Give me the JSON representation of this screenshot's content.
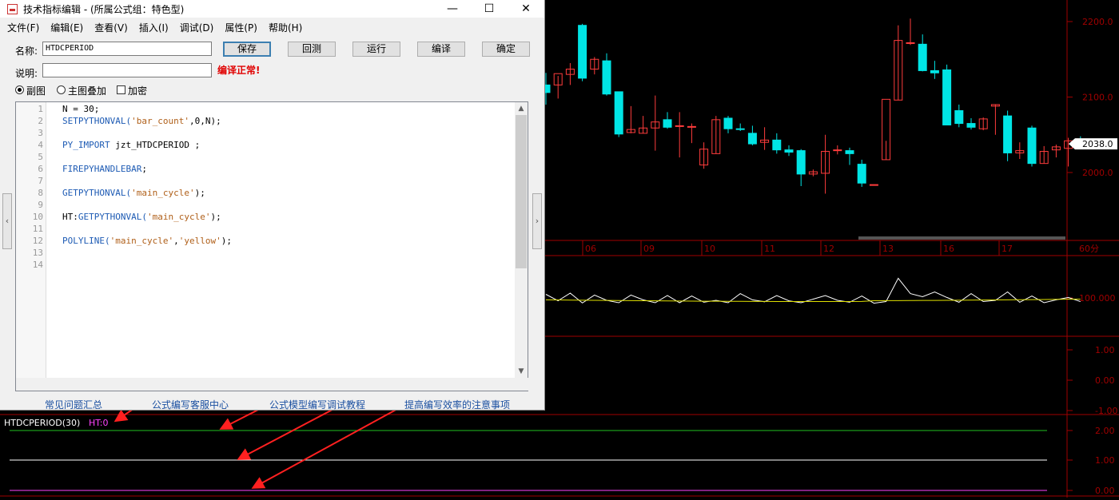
{
  "window": {
    "title": "技术指标编辑 - (所属公式组：特色型)",
    "minimize_glyph": "—",
    "maximize_glyph": "☐",
    "close_glyph": "✕"
  },
  "menu": [
    "文件(F)",
    "编辑(E)",
    "查看(V)",
    "插入(I)",
    "调试(D)",
    "属性(P)",
    "帮助(H)"
  ],
  "form": {
    "name_label": "名称:",
    "name_value": "HTDCPERIOD",
    "desc_label": "说明:",
    "desc_value": "",
    "compile_status": "编译正常!",
    "buttons": [
      "保存",
      "回测",
      "运行",
      "编译",
      "确定"
    ],
    "mode_sub": "副图",
    "mode_overlay": "主图叠加",
    "encrypt": "加密"
  },
  "code_lines": [
    {
      "n": "1",
      "segs": [
        {
          "t": "N = 30;",
          "c": "plain"
        }
      ]
    },
    {
      "n": "2",
      "segs": [
        {
          "t": "SETPYTHONVAL(",
          "c": "kw"
        },
        {
          "t": "'bar_count'",
          "c": "str"
        },
        {
          "t": ",0,N);",
          "c": "plain"
        }
      ]
    },
    {
      "n": "3",
      "segs": []
    },
    {
      "n": "4",
      "segs": [
        {
          "t": "PY_IMPORT",
          "c": "kw"
        },
        {
          "t": " jzt_HTDCPERIOD ;",
          "c": "plain"
        }
      ]
    },
    {
      "n": "5",
      "segs": []
    },
    {
      "n": "6",
      "segs": [
        {
          "t": "FIREPYHANDLEBAR",
          "c": "kw"
        },
        {
          "t": ";",
          "c": "plain"
        }
      ]
    },
    {
      "n": "7",
      "segs": []
    },
    {
      "n": "8",
      "segs": [
        {
          "t": "GETPYTHONVAL(",
          "c": "kw"
        },
        {
          "t": "'main_cycle'",
          "c": "str"
        },
        {
          "t": ");",
          "c": "plain"
        }
      ]
    },
    {
      "n": "9",
      "segs": []
    },
    {
      "n": "10",
      "segs": [
        {
          "t": "HT:",
          "c": "plain"
        },
        {
          "t": "GETPYTHONVAL(",
          "c": "kw"
        },
        {
          "t": "'main_cycle'",
          "c": "str"
        },
        {
          "t": ");",
          "c": "plain"
        }
      ]
    },
    {
      "n": "11",
      "segs": []
    },
    {
      "n": "12",
      "segs": [
        {
          "t": "POLYLINE(",
          "c": "kw"
        },
        {
          "t": "'main_cycle'",
          "c": "str"
        },
        {
          "t": ",",
          "c": "plain"
        },
        {
          "t": "'yellow'",
          "c": "str"
        },
        {
          "t": ");",
          "c": "plain"
        }
      ]
    },
    {
      "n": "13",
      "segs": []
    },
    {
      "n": "14",
      "segs": []
    }
  ],
  "footer_links": [
    "常见问题汇总",
    "公式编写客服中心",
    "公式模型编写调试教程",
    "提高编写效率的注意事项"
  ],
  "side_left_glyph": "‹",
  "side_right_glyph": "›",
  "main_chart": {
    "price_ticks": [
      "2200.0",
      "2100.0",
      "2000.0"
    ],
    "current_price": "2038.0",
    "date_ticks": [
      "06",
      "09",
      "10",
      "11",
      "12",
      "13",
      "16",
      "17"
    ],
    "period": "60分"
  },
  "sub_chart1": {
    "ticks": [
      "100.000"
    ]
  },
  "sub_chart2": {
    "ticks": [
      "1.00",
      "0.00",
      "-1.00"
    ]
  },
  "indicator_panel": {
    "name": "HTDCPERIOD(30)",
    "value": "HT:0",
    "ticks": [
      "2.00",
      "1.00",
      "0.00"
    ]
  },
  "colors": {
    "frame_red": "#a00000",
    "up": "#ff3c3c",
    "down": "#00e5e5",
    "yellow": "#e0e000",
    "magenta": "#ff44ff",
    "annotation_arrow": "#ff2020"
  },
  "candles": [
    {
      "o": 2116,
      "h": 2132,
      "l": 2090,
      "c": 2106
    },
    {
      "o": 2116,
      "h": 2128,
      "l": 2098,
      "c": 2131
    },
    {
      "o": 2130,
      "h": 2145,
      "l": 2116,
      "c": 2137
    },
    {
      "o": 2195,
      "h": 2197,
      "l": 2121,
      "c": 2125
    },
    {
      "o": 2137,
      "h": 2153,
      "l": 2130,
      "c": 2150
    },
    {
      "o": 2148,
      "h": 2158,
      "l": 2102,
      "c": 2104
    },
    {
      "o": 2107,
      "h": 2107,
      "l": 2047,
      "c": 2051
    },
    {
      "o": 2053,
      "h": 2088,
      "l": 2052,
      "c": 2057
    },
    {
      "o": 2052,
      "h": 2075,
      "l": 2052,
      "c": 2059
    },
    {
      "o": 2059,
      "h": 2102,
      "l": 2029,
      "c": 2067
    },
    {
      "o": 2070,
      "h": 2080,
      "l": 2058,
      "c": 2060
    },
    {
      "o": 2062,
      "h": 2080,
      "l": 2020,
      "c": 2062
    },
    {
      "o": 2061,
      "h": 2065,
      "l": 2039,
      "c": 2061
    },
    {
      "o": 2010,
      "h": 2040,
      "l": 2005,
      "c": 2031
    },
    {
      "o": 2025,
      "h": 2075,
      "l": 2025,
      "c": 2070
    },
    {
      "o": 2072,
      "h": 2075,
      "l": 2052,
      "c": 2058
    },
    {
      "o": 2058,
      "h": 2065,
      "l": 2055,
      "c": 2057
    },
    {
      "o": 2052,
      "h": 2062,
      "l": 2036,
      "c": 2038
    },
    {
      "o": 2040,
      "h": 2060,
      "l": 2030,
      "c": 2043
    },
    {
      "o": 2043,
      "h": 2052,
      "l": 2025,
      "c": 2030
    },
    {
      "o": 2030,
      "h": 2036,
      "l": 2022,
      "c": 2027
    },
    {
      "o": 2029,
      "h": 2031,
      "l": 1982,
      "c": 1998
    },
    {
      "o": 1998,
      "h": 2004,
      "l": 1995,
      "c": 2001
    },
    {
      "o": 1999,
      "h": 2050,
      "l": 1972,
      "c": 2028
    },
    {
      "o": 2030,
      "h": 2036,
      "l": 2024,
      "c": 2030
    },
    {
      "o": 2029,
      "h": 2033,
      "l": 2010,
      "c": 2025
    },
    {
      "o": 2011,
      "h": 2017,
      "l": 1981,
      "c": 1986
    },
    {
      "o": 1984,
      "h": 1984,
      "l": 1984,
      "c": 1984
    },
    {
      "o": 2017,
      "h": 2042,
      "l": 2017,
      "c": 2097
    },
    {
      "o": 2096,
      "h": 2195,
      "l": 2096,
      "c": 2175
    },
    {
      "o": 2172,
      "h": 2204,
      "l": 2169,
      "c": 2172
    },
    {
      "o": 2170,
      "h": 2183,
      "l": 2134,
      "c": 2135
    },
    {
      "o": 2135,
      "h": 2148,
      "l": 2124,
      "c": 2132
    },
    {
      "o": 2136,
      "h": 2143,
      "l": 2067,
      "c": 2063
    },
    {
      "o": 2082,
      "h": 2090,
      "l": 2060,
      "c": 2065
    },
    {
      "o": 2065,
      "h": 2072,
      "l": 2057,
      "c": 2060
    },
    {
      "o": 2058,
      "h": 2073,
      "l": 2056,
      "c": 2071
    },
    {
      "o": 2088,
      "h": 2090,
      "l": 2050,
      "c": 2090
    },
    {
      "o": 2075,
      "h": 2082,
      "l": 2015,
      "c": 2026
    },
    {
      "o": 2026,
      "h": 2040,
      "l": 2018,
      "c": 2029
    },
    {
      "o": 2059,
      "h": 2062,
      "l": 2008,
      "c": 2012
    },
    {
      "o": 2012,
      "h": 2035,
      "l": 2012,
      "c": 2028
    },
    {
      "o": 2030,
      "h": 2037,
      "l": 2020,
      "c": 2034
    },
    {
      "o": 2032,
      "h": 2046,
      "l": 2008,
      "c": 2042
    },
    {
      "o": 2042,
      "h": 2048,
      "l": 2036,
      "c": 2038
    }
  ],
  "sub_white": [
    115,
    88,
    120,
    79,
    112,
    90,
    80,
    112,
    92,
    80,
    110,
    80,
    108,
    82,
    90,
    80,
    118,
    92,
    84,
    110,
    88,
    80,
    95,
    110,
    90,
    82,
    108,
    78,
    85,
    182,
    118,
    105,
    125,
    102,
    82,
    118,
    85,
    90,
    125,
    82,
    108,
    80,
    92,
    102,
    85
  ]
}
